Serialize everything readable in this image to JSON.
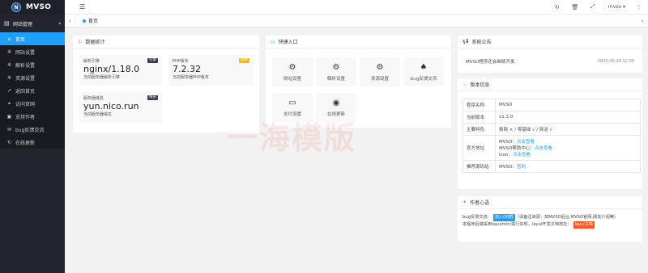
{
  "app": {
    "logo_text": "MVSO",
    "logo_mark": "N"
  },
  "sidebar": {
    "group": {
      "label": "网站管理",
      "icon": "book-icon"
    },
    "items": [
      {
        "label": "首页",
        "icon": "home-icon",
        "active": true
      },
      {
        "label": "网站设置",
        "icon": "gear-icon"
      },
      {
        "label": "解析设置",
        "icon": "gear-icon"
      },
      {
        "label": "资源设置",
        "icon": "gear-icon"
      },
      {
        "label": "返回首页",
        "icon": "share-icon"
      },
      {
        "label": "访问官网",
        "icon": "link-icon"
      },
      {
        "label": "支持作者",
        "icon": "gift-icon"
      },
      {
        "label": "bug反馈交流",
        "icon": "chat-icon"
      },
      {
        "label": "在线更新",
        "icon": "refresh-icon"
      }
    ]
  },
  "header": {
    "user": "mvso"
  },
  "tabs": [
    {
      "label": "首页"
    }
  ],
  "stats_card": {
    "title": "数据统计",
    "items": [
      {
        "label": "解析引擎",
        "value": "nginx/1.18.0",
        "sub": "当前服务器解析引擎",
        "badge": "引擎",
        "badge_color": "#393d49"
      },
      {
        "label": "PHP版本",
        "value": "7.2.32",
        "sub": "当前服务器PHP版本",
        "badge": "版本",
        "badge_color": "#ffb800"
      },
      {
        "label": "服务器域名",
        "value": "yun.nico.run",
        "sub": "当前服务器域名",
        "badge": "域名",
        "badge_color": "#393d49"
      }
    ]
  },
  "quick_card": {
    "title": "快捷入口",
    "items": [
      {
        "label": "网站设置",
        "icon": "cogs-icon"
      },
      {
        "label": "解析设置",
        "icon": "cogs-icon"
      },
      {
        "label": "资源设置",
        "icon": "cogs-icon"
      },
      {
        "label": "bug反馈交流",
        "icon": "qq-icon"
      },
      {
        "label": "支付设置",
        "icon": "card-icon"
      },
      {
        "label": "在线更新",
        "icon": "target-icon"
      }
    ]
  },
  "notice_card": {
    "title": "系统公告",
    "text": "MVSO程序还会继续开发",
    "date": "2020-06-24 12:00"
  },
  "version_card": {
    "title": "版本信息",
    "rows": [
      {
        "key": "程序名称",
        "value": "MVSO"
      },
      {
        "key": "当前版本",
        "value": "v1.3.0"
      },
      {
        "key": "主要特色",
        "value": "极简 × / 零基础 √ / 简洁 √"
      },
      {
        "key": "官方地址",
        "lines": [
          {
            "label": "MVSO：",
            "link": "点击查看"
          },
          {
            "label": "MVSO帮助中心：",
            "link": "点击查看"
          },
          {
            "label": "Icon：",
            "link": "点击查看"
          }
        ]
      },
      {
        "key": "推荐源码站",
        "value": "MVSO：",
        "link": "官网"
      }
    ]
  },
  "author_card": {
    "title": "作者心语",
    "line1_prefix": "bug反馈交流：",
    "qq_button": "加入QQ群",
    "line1_suffix": "（请备注来源：如MVSO后台,MVSO官网,朋友介绍等）",
    "line2": "本程序后端采用layuimini进行实现，layui开发文档地址：",
    "doc_button": "layui文档"
  },
  "watermark": "一海模版",
  "colors": {
    "accent": "#1e9fff",
    "sidebar_bg": "#23262e",
    "badge_warn": "#ffb800",
    "doc_btn": "#ff5722"
  }
}
